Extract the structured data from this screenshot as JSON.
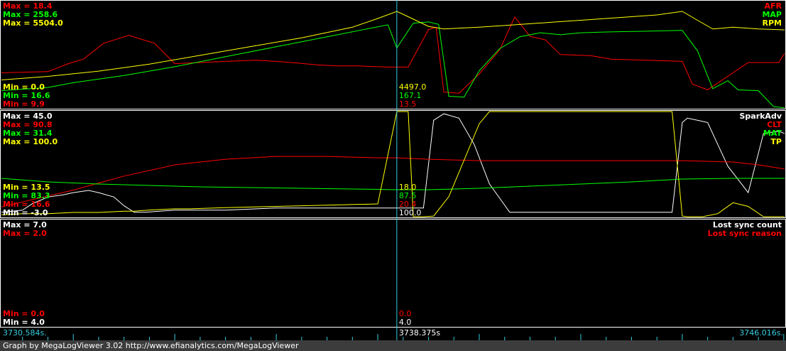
{
  "footer_text": "Graph by MegaLogViewer 3.02 http://www.efianalytics.com/MegaLogViewer",
  "time_axis": {
    "start": "3730.584s.",
    "cursor": "3738.375s",
    "end": "3746.016s."
  },
  "panels": [
    {
      "id": "p1",
      "series": [
        {
          "name": "AFR",
          "color": "#ff0000",
          "max_label": "Max = 18.4",
          "min_label": "Min = 9.9",
          "cursor_value": "13.5"
        },
        {
          "name": "MAP",
          "color": "#00ff00",
          "max_label": "Max = 258.6",
          "min_label": "Min = 16.6",
          "cursor_value": "167.1"
        },
        {
          "name": "RPM",
          "color": "#ffff00",
          "max_label": "Max = 5504.0",
          "min_label": "Min = 0.0",
          "cursor_value": "4497.0"
        }
      ]
    },
    {
      "id": "p2",
      "series": [
        {
          "name": "SparkAdv",
          "color": "#ffffff",
          "max_label": "Max = 45.0",
          "min_label": "Min = -3.0",
          "cursor_value": "100.0"
        },
        {
          "name": "CLT",
          "color": "#ff0000",
          "max_label": "Max = 90.8",
          "min_label": "Min = 16.6",
          "cursor_value": "20.4"
        },
        {
          "name": "MAT",
          "color": "#00ff00",
          "max_label": "Max = 31.4",
          "min_label": "Min = 83.3",
          "cursor_value": "87.5"
        },
        {
          "name": "TP",
          "color": "#ffff00",
          "max_label": "Max = 100.0",
          "min_label": "Min = 13.5",
          "cursor_value": "18.0"
        }
      ]
    },
    {
      "id": "p3",
      "series": [
        {
          "name": "Lost sync count",
          "color": "#ffffff",
          "max_label": "Max = 7.0",
          "min_label": "Min = 4.0",
          "cursor_value": "4.0"
        },
        {
          "name": "Lost sync reason",
          "color": "#ff0000",
          "max_label": "Max = 2.0",
          "min_label": "Min = 0.0",
          "cursor_value": "0.0"
        }
      ]
    }
  ],
  "chart_data": {
    "type": "line",
    "x_range": [
      3730.584,
      3746.016
    ],
    "cursor_x": 3738.375,
    "panels": [
      {
        "series": [
          {
            "name": "AFR",
            "color": "#ff0000",
            "ylim": [
              9.9,
              18.4
            ],
            "x": [
              3730.584,
              3731.5,
              3731.9,
              3732.2,
              3732.6,
              3733.1,
              3733.3,
              3733.6,
              3734.0,
              3734.5,
              3735.0,
              3735.6,
              3736.0,
              3736.3,
              3736.8,
              3737.2,
              3737.6,
              3738.2,
              3738.375,
              3738.6,
              3739.0,
              3739.15,
              3739.3,
              3739.6,
              3740.0,
              3740.4,
              3740.7,
              3741.0,
              3741.3,
              3741.6,
              3742.2,
              3742.6,
              3743.3,
              3744.0,
              3744.2,
              3744.5,
              3744.8,
              3745.3,
              3745.9,
              3746.016
            ],
            "y": [
              13.0,
              13.1,
              13.8,
              14.2,
              15.6,
              16.3,
              16.0,
              15.6,
              13.8,
              13.9,
              14.0,
              14.1,
              14.0,
              13.9,
              13.7,
              13.6,
              13.6,
              13.5,
              13.5,
              13.5,
              16.8,
              17.0,
              11.3,
              11.2,
              12.9,
              15.0,
              17.9,
              16.2,
              15.9,
              14.6,
              14.5,
              14.2,
              14.1,
              14.0,
              12.0,
              11.5,
              12.4,
              13.9,
              13.9,
              14.7
            ]
          },
          {
            "name": "MAP",
            "color": "#00ff00",
            "ylim": [
              16.6,
              258.6
            ],
            "x": [
              3730.584,
              3731.5,
              3732.0,
              3733.0,
              3734.0,
              3735.0,
              3736.0,
              3737.0,
              3737.8,
              3738.2,
              3738.375,
              3738.7,
              3739.0,
              3739.2,
              3739.4,
              3739.7,
              3740.0,
              3740.4,
              3740.8,
              3741.2,
              3741.6,
              3742.0,
              3742.5,
              3743.3,
              3744.0,
              3744.3,
              3744.6,
              3744.9,
              3745.1,
              3745.5,
              3745.8,
              3746.016
            ],
            "y": [
              60,
              68,
              80,
              98,
              120,
              145,
              170,
              195,
              215,
              225,
              167.1,
              229,
              232,
              226,
              46,
              44,
              110,
              165,
              195,
              205,
              200,
              205,
              207,
              209,
              211,
              160,
              65,
              85,
              62,
              60,
              20,
              17
            ]
          },
          {
            "name": "RPM",
            "color": "#ffff00",
            "ylim": [
              0,
              5504
            ],
            "x": [
              3730.584,
              3731.5,
              3732.5,
              3733.5,
              3734.5,
              3735.5,
              3736.5,
              3737.5,
              3738.0,
              3738.375,
              3738.6,
              3739.0,
              3739.3,
              3739.6,
              3740.0,
              3740.5,
              3741.0,
              3741.5,
              3742.0,
              3742.5,
              3743.0,
              3743.5,
              3744.0,
              3744.3,
              3744.6,
              3745.0,
              3745.5,
              3746.0,
              3746.016
            ],
            "y": [
              1600,
              1800,
              2100,
              2500,
              3000,
              3500,
              4000,
              4600,
              5100,
              5504,
              5200,
              4650,
              4500,
              4550,
              4600,
              4700,
              4800,
              4900,
              5000,
              5100,
              5200,
              5300,
              5504,
              5000,
              4500,
              4600,
              4500,
              4450,
              4450
            ]
          }
        ]
      },
      {
        "series": [
          {
            "name": "SparkAdv",
            "color": "#ffffff",
            "ylim": [
              -3.0,
              45.0
            ],
            "x": [
              3730.584,
              3731.0,
              3731.2,
              3731.5,
              3731.8,
              3732.0,
              3732.3,
              3732.5,
              3732.8,
              3733.0,
              3733.2,
              3733.4,
              3734.0,
              3735.0,
              3736.0,
              3737.0,
              3738.0,
              3738.375,
              3738.9,
              3739.1,
              3739.3,
              3739.6,
              3739.9,
              3740.2,
              3740.6,
              3742.5,
              3743.8,
              3744.0,
              3744.1,
              3744.3,
              3744.5,
              3744.7,
              3744.9,
              3745.1,
              3745.3,
              3745.6,
              3745.9,
              3746.016
            ],
            "y": [
              -1,
              0,
              3,
              6,
              7,
              8,
              9,
              8,
              6,
              2,
              -1,
              -1,
              0,
              0,
              1,
              1,
              1,
              1,
              1,
              41,
              44,
              42,
              30,
              12,
              -1,
              -1,
              -1,
              40,
              42,
              41,
              40,
              30,
              20,
              14,
              8,
              35,
              36,
              35
            ]
          },
          {
            "name": "CLT",
            "color": "#ff0000",
            "ylim": [
              83.3,
              90.8
            ],
            "x": [
              3730.584,
              3732.0,
              3733.0,
              3734.0,
              3735.0,
              3736.0,
              3737.0,
              3738.0,
              3738.375,
              3739.0,
              3740.0,
              3742.0,
              3744.0,
              3745.0,
              3745.5,
              3746.016
            ],
            "y": [
              84.0,
              85.2,
              86.2,
              87.0,
              87.4,
              87.6,
              87.6,
              87.5,
              87.5,
              87.4,
              87.3,
              87.3,
              87.3,
              87.2,
              87.0,
              86.7
            ]
          },
          {
            "name": "MAT",
            "color": "#00ff00",
            "ylim": [
              16.6,
              31.4
            ],
            "x": [
              3730.584,
              3731.5,
              3732.5,
              3733.5,
              3734.5,
              3735.5,
              3736.5,
              3737.5,
              3738.375,
              3739.0,
              3740.0,
              3741.0,
              3742.0,
              3743.0,
              3744.0,
              3745.0,
              3746.016
            ],
            "y": [
              22.0,
              21.5,
              21.2,
              21.0,
              20.8,
              20.7,
              20.6,
              20.5,
              20.4,
              20.4,
              20.6,
              20.9,
              21.2,
              21.5,
              21.9,
              22.0,
              22.0
            ]
          },
          {
            "name": "TP",
            "color": "#ffff00",
            "ylim": [
              13.5,
              100.0
            ],
            "x": [
              3730.584,
              3731.0,
              3731.5,
              3732.0,
              3732.5,
              3733.0,
              3733.2,
              3733.5,
              3734.0,
              3734.3,
              3735.0,
              3736.0,
              3737.0,
              3738.0,
              3738.375,
              3738.6,
              3738.7,
              3738.9,
              3739.1,
              3739.4,
              3739.7,
              3740.0,
              3740.2,
              3740.4,
              3743.0,
              3743.8,
              3744.0,
              3744.1,
              3744.4,
              3744.7,
              3745.0,
              3745.3,
              3745.6,
              3746.016
            ],
            "y": [
              15,
              16,
              16,
              17,
              17,
              18,
              18,
              19,
              20,
              20,
              21,
              22,
              23,
              24,
              100,
              100,
              13.5,
              13.5,
              14,
              30,
              60,
              90,
              100,
              100,
              100,
              100,
              14,
              13.5,
              13.5,
              16,
              25,
              22,
              13.5,
              13.5
            ]
          }
        ]
      },
      {
        "series": [
          {
            "name": "Lost sync count",
            "color": "#ffffff",
            "ylim": [
              4.0,
              7.0
            ],
            "x": [],
            "y": []
          },
          {
            "name": "Lost sync reason",
            "color": "#ff0000",
            "ylim": [
              0.0,
              2.0
            ],
            "x": [],
            "y": []
          }
        ]
      }
    ]
  }
}
